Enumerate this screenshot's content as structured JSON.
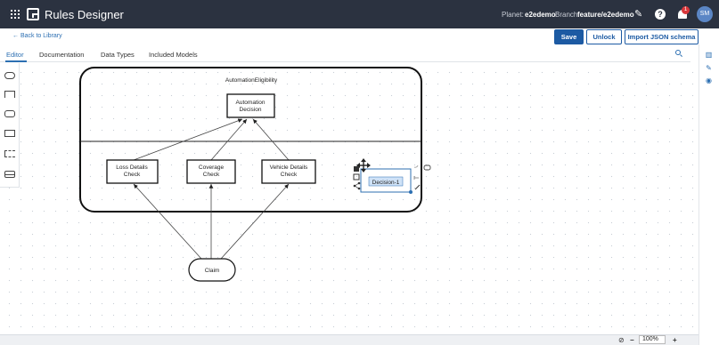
{
  "topbar": {
    "app_title": "Rules Designer",
    "planet_label": "Planet:",
    "planet_value": "e2edemo",
    "branch_label": "Branch:",
    "branch_value": "feature/e2edemo",
    "notification_count": "1",
    "user_initials": "SM"
  },
  "subheader": {
    "back_link": "← Back to Library",
    "save_label": "Save",
    "unlock_label": "Unlock",
    "import_label": "Import JSON schema"
  },
  "tabs": [
    "Editor",
    "Documentation",
    "Data Types",
    "Included Models"
  ],
  "diagram": {
    "container_title": "AutomationEligibility",
    "decision_line1": "Automation",
    "decision_line2": "Decision",
    "box1_line1": "Loss Details",
    "box1_line2": "Check",
    "box2_line1": "Coverage",
    "box2_line2": "Check",
    "box3_line1": "Vehicle Details",
    "box3_line2": "Check",
    "input_label": "Claim",
    "selected_label": "Decision-1"
  },
  "zoom": {
    "value": "100%",
    "minus": "−",
    "plus": "+"
  },
  "colors": {
    "topbar": "#2b3240",
    "accent": "#1c5aa3",
    "selection": "#2c6fb2"
  }
}
